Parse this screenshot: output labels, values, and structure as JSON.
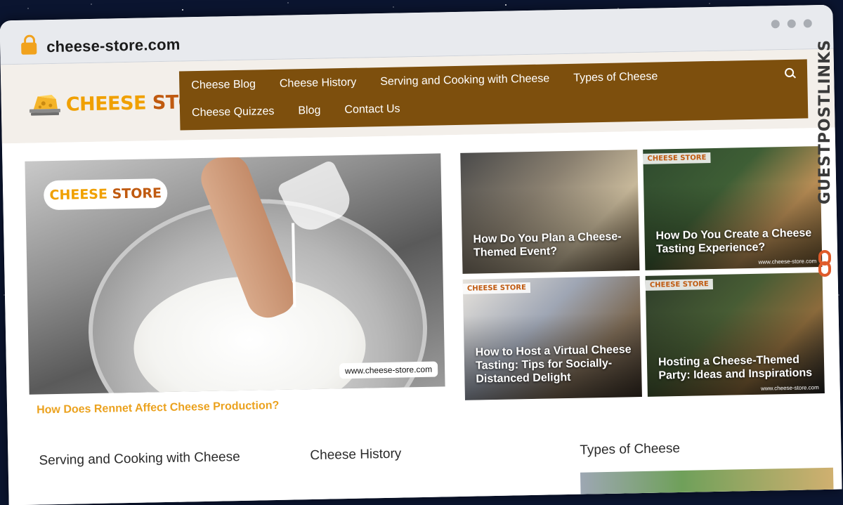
{
  "browser": {
    "url": "cheese-store.com"
  },
  "site": {
    "logo_text_1": "CHEESE",
    "logo_text_2": "STORE",
    "nav": {
      "row1": [
        "Cheese Blog",
        "Cheese History",
        "Serving and Cooking with Cheese",
        "Types of Cheese"
      ],
      "row2": [
        "Cheese Quizzes",
        "Blog",
        "Contact Us"
      ]
    }
  },
  "hero": {
    "logo_text_1": "CHEESE",
    "logo_text_2": "STORE",
    "watermark_url": "www.cheese-store.com",
    "title": "How Does Rennet Affect Cheese Production?"
  },
  "cards": [
    {
      "title": "How Do You Plan a Cheese-Themed Event?",
      "logo": "",
      "url": ""
    },
    {
      "title": "How Do You Create a Cheese Tasting Experience?",
      "logo": "CHEESE STORE",
      "url": "www.cheese-store.com"
    },
    {
      "title": "How to Host a Virtual Cheese Tasting: Tips for Socially-Distanced Delight",
      "logo": "CHEESE STORE",
      "url": ""
    },
    {
      "title": "Hosting a Cheese-Themed Party: Ideas and Inspirations",
      "logo": "CHEESE STORE",
      "url": "www.cheese-store.com"
    }
  ],
  "sections": {
    "s1": "Serving and Cooking with Cheese",
    "s2": "Cheese History",
    "s3": "Types of Cheese"
  },
  "overlay": {
    "brand": "GUESTPOSTLINKS"
  },
  "colors": {
    "nav_bg": "#7d4f0d",
    "accent": "#eba21f",
    "header_bg": "#f3efea"
  }
}
